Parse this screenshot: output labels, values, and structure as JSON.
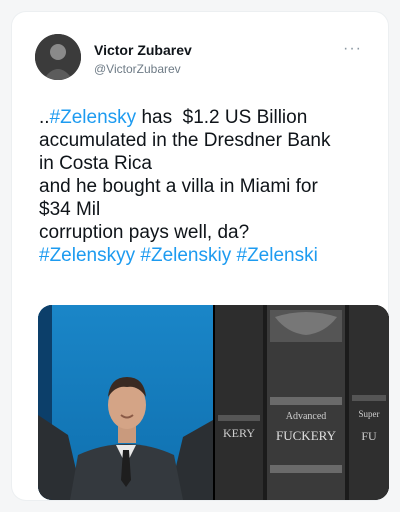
{
  "author": {
    "display_name": "Victor Zubarev",
    "handle": "@VictorZubarev"
  },
  "menu_icon": "more-dots-icon",
  "tweet": {
    "line1_prefix": "..",
    "line1_tag": "#Zelensky",
    "line1_suffix": " has  $1.2 US Billion",
    "line2": "accumulated in the Dresdner Bank",
    "line3": "in Costa Rica",
    "line4": "and he bought a villa in Miami for",
    "line5": "$34 Mil",
    "line6": "corruption pays well, da?",
    "hashtags": [
      "#Zelenskyy",
      "#Zelenskiy",
      "#Zelenski"
    ]
  },
  "media": {
    "book_left_text": "KERY",
    "book_center_line1": "Advanced",
    "book_center_line2": "FUCKERY",
    "book_right_line1": "Super",
    "book_right_line2": "FU"
  },
  "colors": {
    "link": "#1d9bf0",
    "text": "#0f1419",
    "secondary": "#6e7b86",
    "photo_left_bg": "#1c8fd1"
  }
}
